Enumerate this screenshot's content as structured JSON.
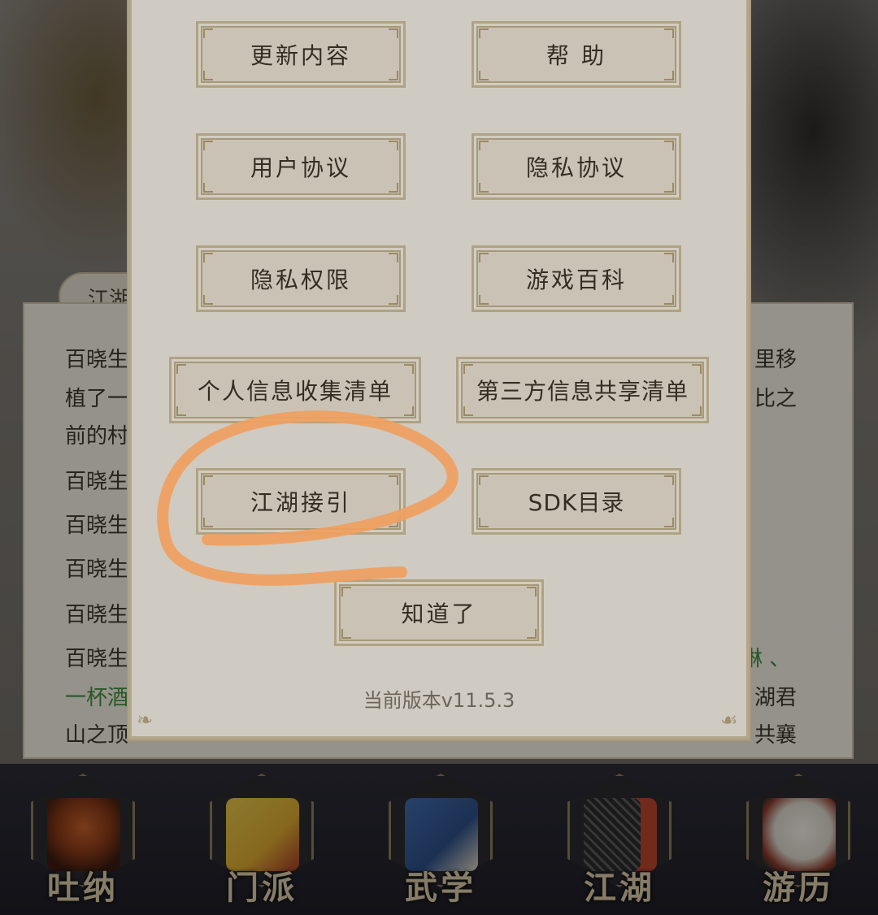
{
  "background": {
    "tab_label": "江湖",
    "lines": [
      {
        "text": "百晓生",
        "color": "normal"
      },
      {
        "text": "植了一",
        "color": "normal"
      },
      {
        "text": "前的村",
        "color": "normal"
      },
      {
        "text": "百晓生",
        "color": "normal"
      },
      {
        "text": "百晓生",
        "color": "normal"
      },
      {
        "text": "百晓生",
        "color": "normal"
      },
      {
        "text": "百晓生",
        "color": "normal"
      },
      {
        "text": "百晓生",
        "color": "normal"
      },
      {
        "text": "一杯酒",
        "color": "green"
      },
      {
        "text": "山之顶",
        "color": "normal"
      }
    ],
    "right_fragments": [
      "里移",
      "比之",
      "琳 、",
      "湖君",
      "共襄"
    ]
  },
  "dialog": {
    "buttons": {
      "update": "更新内容",
      "help": "帮 助",
      "user_agreement": "用户协议",
      "privacy_agreement": "隐私协议",
      "privacy_permissions": "隐私权限",
      "game_wiki": "游戏百科",
      "personal_info_list": "个人信息收集清单",
      "third_party_list": "第三方信息共享清单",
      "jianghu_guide": "江湖接引",
      "sdk_list": "SDK目录",
      "ok": "知道了"
    },
    "version": "当前版本v11.5.3"
  },
  "bottom_nav": {
    "items": [
      {
        "label": "吐纳",
        "icon": "meditating-monk-icon"
      },
      {
        "label": "门派",
        "icon": "sect-banner-icon"
      },
      {
        "label": "武学",
        "icon": "martial-book-icon"
      },
      {
        "label": "江湖",
        "icon": "fishing-net-icon"
      },
      {
        "label": "游历",
        "icon": "white-horse-icon"
      }
    ]
  },
  "annotation": {
    "color": "#f0a060",
    "target": "江湖接引"
  }
}
